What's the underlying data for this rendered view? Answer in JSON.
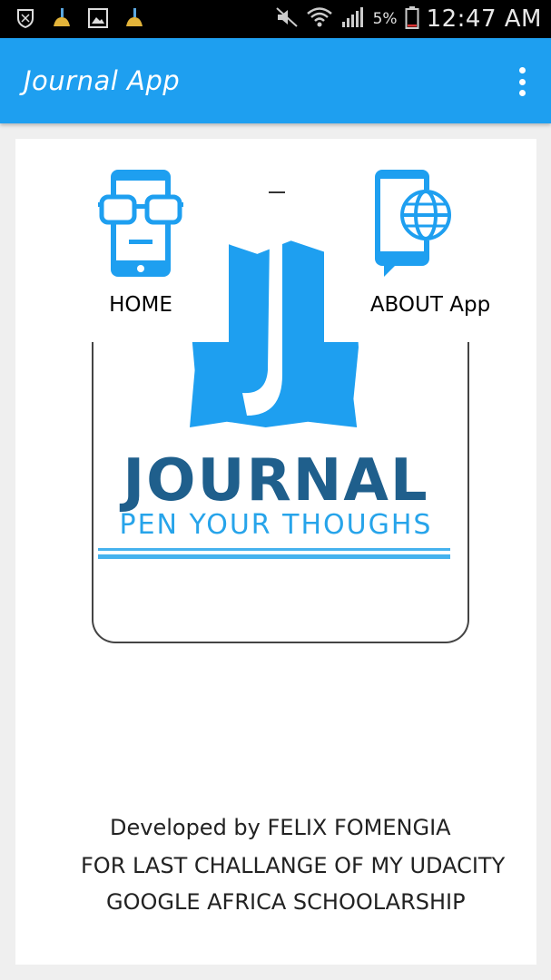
{
  "status_bar": {
    "battery_percent": "5%",
    "time": "12:47 AM",
    "icons": [
      "shield-icon",
      "cleaner-icon",
      "gallery-icon",
      "cleaner-icon",
      "mute-icon",
      "wifi-icon",
      "signal-icon",
      "battery-icon"
    ]
  },
  "app_bar": {
    "title": "Journal App",
    "overflow_icon": "more-vert-icon",
    "color": "#1e9ff0"
  },
  "menu": {
    "home_label": "HOME",
    "about_label": "ABOUT App"
  },
  "logo": {
    "title": "JOURNAL",
    "tagline": "PEN YOUR THOUGHS"
  },
  "credits": {
    "line1": "Developed by FELIX FOMENGIA",
    "line2": "FOR LAST CHALLANGE OF MY UDACITY",
    "line3": "GOOGLE AFRICA SCHOOLARSHIP"
  }
}
